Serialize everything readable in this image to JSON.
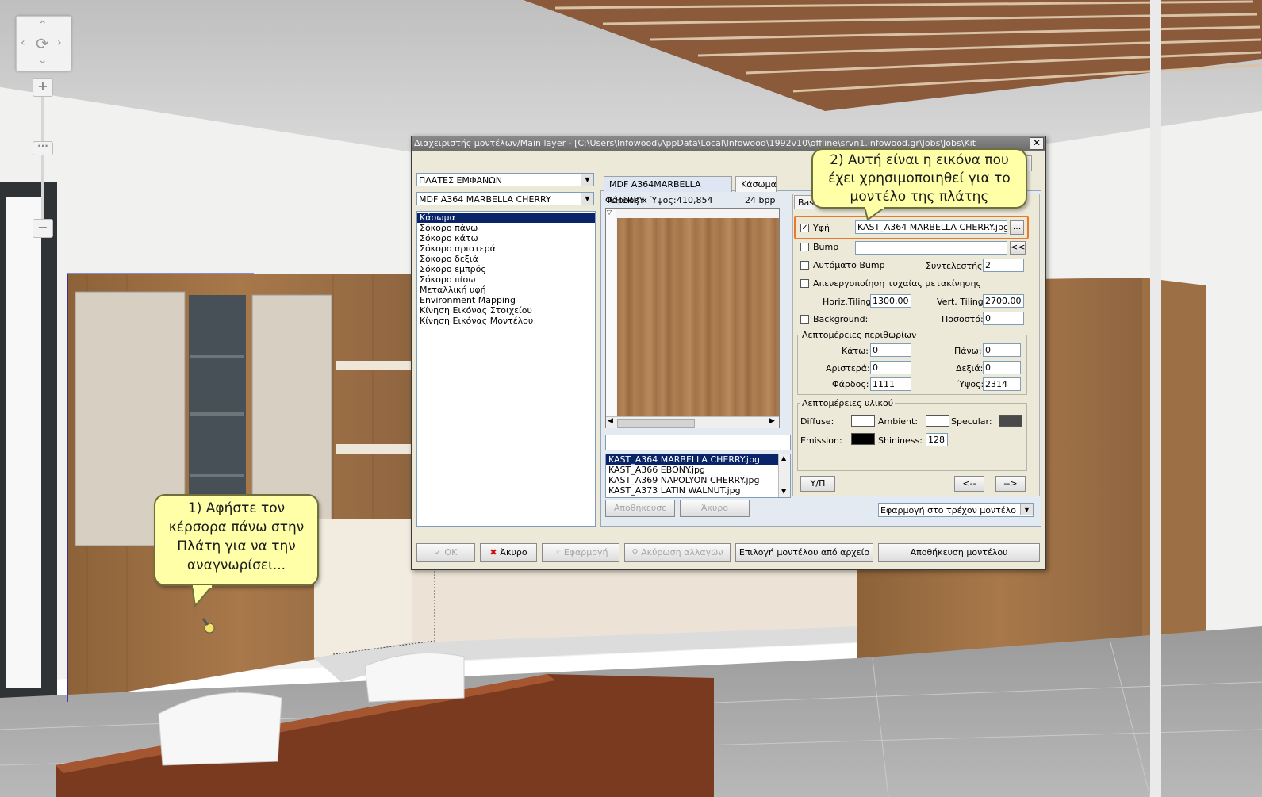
{
  "scene": {
    "callout1": [
      "1) Αφήστε τον",
      "κέρσορα πάνω στην",
      "Πλάτη για να την",
      "αναγνωρίσει..."
    ],
    "callout2": [
      "2) Αυτή είναι η εικόνα που",
      "έχει χρησιμοποιηθεί για το",
      "μοντέλο της πλάτης"
    ]
  },
  "dialog": {
    "title": "Διαχειριστής μοντέλων/Main layer - [C:\\Users\\Infowood\\AppData\\Local\\Infowood\\1992v10\\offline\\srvn1.infowood.gr\\Jobs\\Jobs\\Kit",
    "close": "✕",
    "hidden_tab_fragment": "n",
    "category_combo": "ΠΛΑΤΕΣ ΕΜΦΑΝΩΝ",
    "model_combo": "MDF A364 MARBELLA CHERRY",
    "part_list": [
      "Κάσωμα",
      "Σόκορο πάνω",
      "Σόκορο κάτω",
      "Σόκορο αριστερά",
      "Σόκορο δεξιά",
      "Σόκορο εμπρός",
      "Σόκορο πίσω",
      "Μεταλλική υφή",
      "Environment Mapping",
      "Κίνηση Εικόνας Στοιχείου",
      "Κίνηση Εικόνας Μοντέλου"
    ],
    "tab_model": "MDF A364MARBELLA CHERRY",
    "tab_casing": "Κάσωμα",
    "tab_basic": "Bas",
    "size_label": "Φάρδος x Ύψος:",
    "size_value": "410,854",
    "bpp": "24 bpp",
    "texture_files": [
      "KAST_A364 MARBELLA CHERRY.jpg",
      "KAST_A366 EBONY.jpg",
      "KAST_A369 NAPOLYON CHERRY.jpg",
      "KAST_A373 LATIN WALNUT.jpg"
    ],
    "save_btn": "Αποθήκευσε",
    "cancel_small_btn": "Άκυρο",
    "texture": {
      "label": "Υφή",
      "checked": "✓",
      "value": "KAST_A364 MARBELLA CHERRY.jpg",
      "browse": "..."
    },
    "bump": {
      "label": "Bump",
      "value": "",
      "btn": "<<"
    },
    "auto_bump": "Αυτόματο Bump",
    "factor_label": "Συντελεστής:",
    "factor_value": "2",
    "disable_random": "Απενεργοποίηση τυχαίας μετακίνησης",
    "horiz_label": "Horiz.Tiling:",
    "horiz_value": "1300.00",
    "vert_label": "Vert. Tiling:",
    "vert_value": "2700.00",
    "background_label": "Background:",
    "percent_label": "Ποσοστό:",
    "percent_value": "0",
    "margins_group": "Λεπτομέρειες περιθωρίων",
    "bottom_label": "Κάτω:",
    "bottom_value": "0",
    "top_label": "Πάνω:",
    "top_value": "0",
    "left_label": "Αριστερά:",
    "left_value": "0",
    "right_label": "Δεξιά:",
    "right_value": "0",
    "width_label": "Φάρδος:",
    "width_value": "1111",
    "height_label": "Ύψος:",
    "height_value": "2314",
    "material_group": "Λεπτομέρειες υλικού",
    "diffuse_label": "Diffuse:",
    "ambient_label": "Ambient:",
    "specular_label": "Specular:",
    "emission_label": "Emission:",
    "shininess_label": "Shininess:",
    "shininess_value": "128",
    "yp_btn": "Υ/Π",
    "prev_btn": "<--",
    "next_btn": "-->",
    "apply_combo": "Εφαρμογή στο τρέχον μοντέλο",
    "ok_btn": "OK",
    "cancel_btn": "Άκυρο",
    "apply_btn": "Εφαρμογή",
    "revert_btn": "Ακύρωση αλλαγών",
    "choose_file_btn": "Επιλογή μοντέλου από αρχείο",
    "save_model_btn": "Αποθήκευση μοντέλου",
    "colors": {
      "diffuse": "#ffffff",
      "ambient": "#ffffff",
      "specular": "#4a4a4a",
      "emission": "#000000",
      "selection": "#0a246a",
      "highlight": "#e8792a"
    }
  }
}
